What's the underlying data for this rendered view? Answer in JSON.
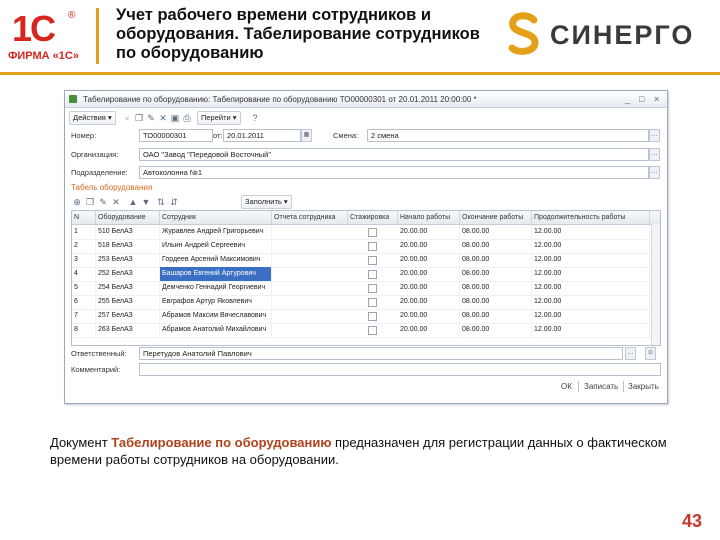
{
  "header": {
    "logo_1c": "1С",
    "logo_reg": "®",
    "logo_firm": "ФИРМА «1С»",
    "title": "Учет рабочего времени сотрудников и оборудования. Табелирование сотрудников по оборудованию",
    "sinergo": "СИНЕРГО"
  },
  "window": {
    "title": "Табелирование по оборудованию: Табелирование по оборудованию ТО00000301 от 20.01.2011 20:00:00 *",
    "controls": [
      "_",
      "□",
      "×"
    ],
    "toolbar": {
      "actions_label": "Действия",
      "goto_label": "Перейти"
    },
    "fields": {
      "number_label": "Номер:",
      "number_value": "ТО00000301",
      "date_label": "от:",
      "date_value": "20.01.2011",
      "shift_label": "Смена:",
      "shift_value": "2 смена",
      "org_label": "Организация:",
      "org_value": "ОАО \"Завод \"Передовой Восточный\"",
      "dept_label": "Подразделение:",
      "dept_value": "Автоколонна №1"
    },
    "section_title": "Табель оборудования",
    "table_toolbar": {
      "fill_label": "Заполнить"
    },
    "table": {
      "columns": [
        "N",
        "Оборудование",
        "Сотрудник",
        "Отчета сотрудника",
        "Стажировка",
        "Начало работы",
        "Окончание работы",
        "Продолжительность работы"
      ],
      "rows": [
        {
          "n": "1",
          "equipment": "510 БелАЗ",
          "employee": "Журавлев Андрей Григорьевич",
          "start": "20.00.00",
          "end": "08.00.00",
          "duration": "12.00.00"
        },
        {
          "n": "2",
          "equipment": "518 БелАЗ",
          "employee": "Ильин Андрей Сергеевич",
          "start": "20.00.00",
          "end": "08.00.00",
          "duration": "12.00.00"
        },
        {
          "n": "3",
          "equipment": "253 БелАЗ",
          "employee": "Гордеев Арсений Максимович",
          "start": "20.00.00",
          "end": "08.00.00",
          "duration": "12.00.00"
        },
        {
          "n": "4",
          "equipment": "252 БелАЗ",
          "employee": "Башаров Евгений Артурович",
          "start": "20.00.00",
          "end": "08.00.00",
          "duration": "12.00.00"
        },
        {
          "n": "5",
          "equipment": "254 БелАЗ",
          "employee": "Демченко Геннадий Георгиевич",
          "start": "20.00.00",
          "end": "08.00.00",
          "duration": "12.00.00"
        },
        {
          "n": "6",
          "equipment": "255 БелАЗ",
          "employee": "Евграфов Артур Яковлевич",
          "start": "20.00.00",
          "end": "08.00.00",
          "duration": "12.00.00"
        },
        {
          "n": "7",
          "equipment": "257 БелАЗ",
          "employee": "Абрамов Максим Вячеславович",
          "start": "20.00.00",
          "end": "08.00.00",
          "duration": "12.00.00"
        },
        {
          "n": "8",
          "equipment": "263 БелАЗ",
          "employee": "Абрамов Анатолий Михайлович",
          "start": "20.00.00",
          "end": "08.00.00",
          "duration": "12.00.00"
        }
      ],
      "selected_row": 3
    },
    "responsible_label": "Ответственный:",
    "responsible_value": "Перетудов Анатолий Павлович",
    "comment_label": "Комментарий:",
    "comment_value": "",
    "bottom": {
      "ok": "ОК",
      "save": "Записать",
      "close": "Закрыть"
    }
  },
  "caption": {
    "prefix": "Документ ",
    "highlight": "Табелирование по оборудованию",
    "suffix": " предназначен для регистрации данных о фактическом времени работы сотрудников на оборудовании."
  },
  "page_number": "43",
  "colors": {
    "accent_orange": "#e4a019",
    "brand_red": "#d7261e",
    "selection_blue": "#3b6fc4",
    "caption_highlight": "#b0431c"
  }
}
